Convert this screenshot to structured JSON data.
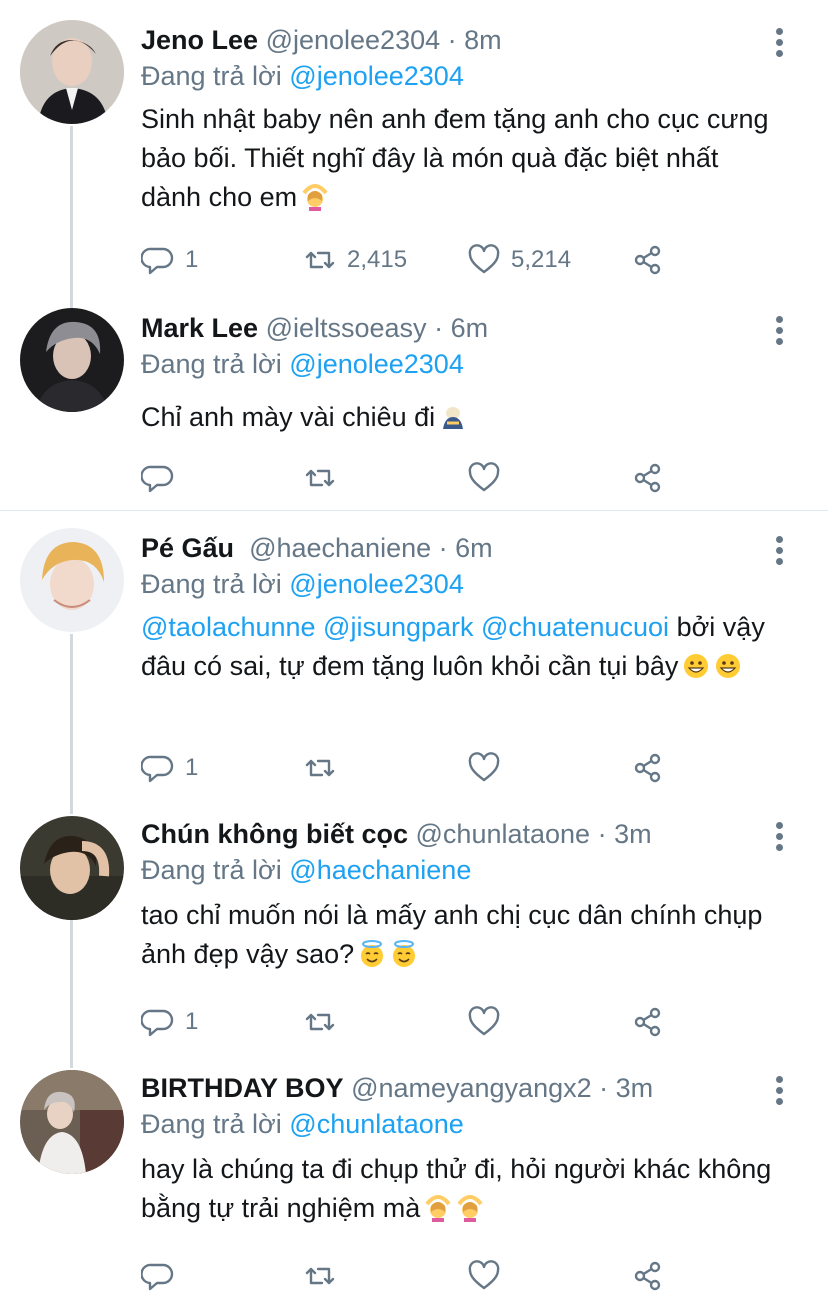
{
  "tweets": [
    {
      "name": "Jeno Lee",
      "handle": "@jenolee2304",
      "time": "8m",
      "reply_label": "Đang trả lời",
      "reply_to": "@jenolee2304",
      "text": "Sinh nhật baby nên anh đem tặng anh cho cục cưng bảo bối. Thiết nghĩ đây là món quà đặc biệt nhất dành cho em",
      "emojis": [
        "woman-gesturing-ok-emoji"
      ],
      "replies": "1",
      "retweets": "2,415",
      "likes": "5,214"
    },
    {
      "name": "Mark Lee",
      "handle": "@ieltssoeasy",
      "time": "6m",
      "reply_label": "Đang trả lời",
      "reply_to": "@jenolee2304",
      "text": "Chỉ anh mày vài chiêu đi",
      "emojis": [
        "person-bowing-emoji"
      ],
      "replies": "",
      "retweets": "",
      "likes": ""
    },
    {
      "name": "Pé Gấu",
      "handle": "@haechaniene",
      "time": "6m",
      "reply_label": "Đang trả lời",
      "reply_to": "@jenolee2304",
      "mentions": "@taolachunne @jisungpark @chuatenucuoi",
      "text": "bởi vậy đâu có sai, tự đem tặng luôn khỏi cần tụi bây",
      "emojis": [
        "grinning-face-emoji",
        "grinning-face-emoji"
      ],
      "replies": "1",
      "retweets": "",
      "likes": ""
    },
    {
      "name": "Chún không biết cọc",
      "handle": "@chunlataone",
      "time": "3m",
      "reply_label": "Đang trả lời",
      "reply_to": "@haechaniene",
      "text": "tao chỉ muốn nói là mấy anh chị cục dân chính chụp ảnh đẹp vậy sao?",
      "emojis": [
        "smiling-face-with-halo-emoji",
        "smiling-face-with-halo-emoji"
      ],
      "replies": "1",
      "retweets": "",
      "likes": ""
    },
    {
      "name": "BIRTHDAY BOY",
      "handle": "@nameyangyangx2",
      "time": "3m",
      "reply_label": "Đang trả lời",
      "reply_to": "@chunlataone",
      "text": "hay là chúng ta đi chụp thử đi, hỏi người khác không bằng tự trải nghiệm mà",
      "emojis": [
        "woman-gesturing-ok-emoji",
        "woman-gesturing-ok-emoji"
      ],
      "replies": "",
      "retweets": "",
      "likes": ""
    }
  ],
  "separator": "·",
  "colors": {
    "link": "#1da1f2",
    "muted": "#657786",
    "text": "#14171a",
    "thread": "#d3d8dc"
  }
}
